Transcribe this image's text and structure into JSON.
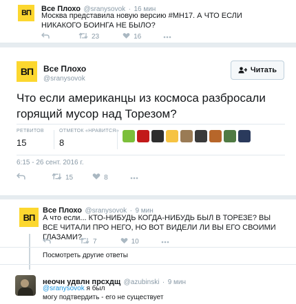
{
  "top_tweet": {
    "logo_text": "ВП",
    "name": "Все Плохо",
    "handle": "@sranysovok",
    "separator": "·",
    "time": "16 мин",
    "text": "Москва представила новую версию #MH17. А ЧТО ЕСЛИ НИКАКОГО БОИНГА НЕ БЫЛО?",
    "retweets": "23",
    "likes": "16"
  },
  "main_tweet": {
    "logo_text": "ВП",
    "name": "Все Плохо",
    "handle": "@sranysovok",
    "follow_label": "Читать",
    "text": "Что если американцы из космоса разбросали горящий мусор над Торезом?",
    "retweets_label": "РЕТВИТОВ",
    "retweets": "15",
    "likes_label": "ОТМЕТОК «НРАВИТСЯ»",
    "likes": "8",
    "timestamp": "6:15 - 26 сент. 2016 г.",
    "action_retweets": "15",
    "action_likes": "8",
    "liker_colors": [
      "#7cbf3a",
      "#c21a1a",
      "#2e2e2e",
      "#f6c342",
      "#9a7b55",
      "#3a3a3a",
      "#b7662a",
      "#4f7a43",
      "#2a3a5c"
    ]
  },
  "reply_tweet": {
    "logo_text": "ВП",
    "name": "Все Плохо",
    "handle": "@sranysovok",
    "separator": "·",
    "time": "9 мин",
    "text": "А что если... КТО-НИБУДЬ КОГДА-НИБУДЬ БЫЛ В ТОРЕЗЕ? ВЫ ВСЕ ЧИТАЛИ ПРО НЕГО, НО ВОТ ВИДЕЛИ ЛИ ВЫ ЕГО СВОИМИ ГЛАЗАМИ?",
    "retweets": "7",
    "likes": "10"
  },
  "more_replies_label": "Посмотреть другие ответы",
  "bottom_reply": {
    "name": "неочн удвлн прсхдщ",
    "handle": "@azubinski",
    "separator": "·",
    "time": "9 мин",
    "mention": "@sranysovok",
    "text_after_mention": " я был",
    "text_line2": "могу подтвердить - его не существует"
  }
}
